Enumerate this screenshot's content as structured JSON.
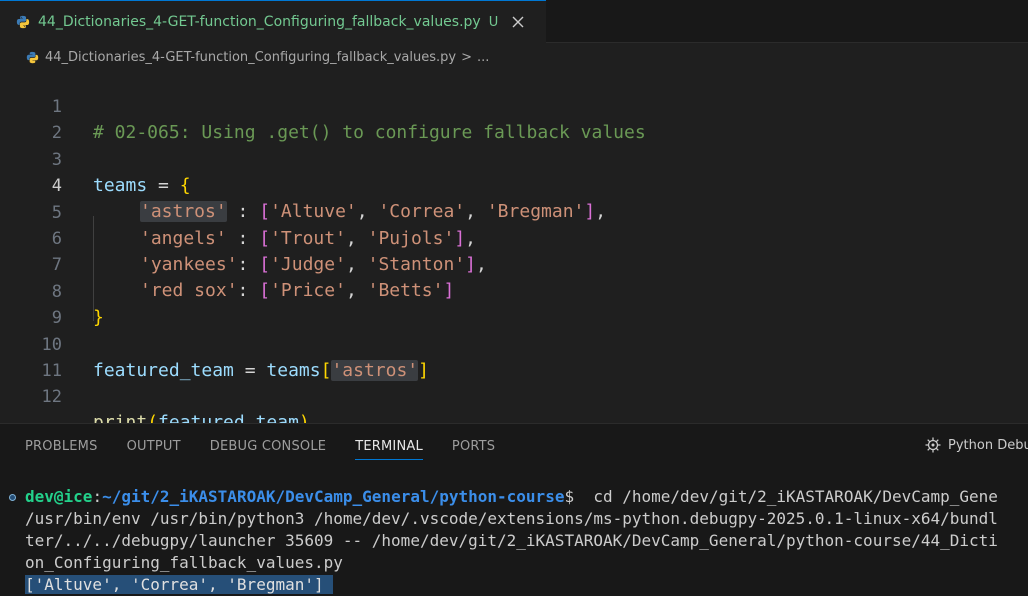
{
  "tab": {
    "title": "44_Dictionaries_4-GET-function_Configuring_fallback_values.py",
    "status": "U"
  },
  "breadcrumb": {
    "file": "44_Dictionaries_4-GET-function_Configuring_fallback_values.py",
    "separator": ">",
    "more": "..."
  },
  "editor": {
    "line_numbers": [
      "1",
      "2",
      "3",
      "4",
      "5",
      "6",
      "7",
      "8",
      "9",
      "10",
      "11",
      "12"
    ],
    "line1": {
      "comment": "# 02-065: Using .get() to configure fallback values"
    },
    "line3": {
      "var": "teams",
      "op": " = ",
      "brace": "{"
    },
    "line4": {
      "key": "'astros'",
      "colon": " : ",
      "open": "[",
      "v1": "'Altuve'",
      "c1": ", ",
      "v2": "'Correa'",
      "c2": ", ",
      "v3": "'Bregman'",
      "close": "]",
      "end": ","
    },
    "line5": {
      "key": "'angels'",
      "colon": " : ",
      "open": "[",
      "v1": "'Trout'",
      "c1": ", ",
      "v2": "'Pujols'",
      "close": "]",
      "end": ","
    },
    "line6": {
      "key": "'yankees'",
      "colon": ": ",
      "open": "[",
      "v1": "'Judge'",
      "c1": ", ",
      "v2": "'Stanton'",
      "close": "]",
      "end": ","
    },
    "line7": {
      "key": "'red sox'",
      "colon": ": ",
      "open": "[",
      "v1": "'Price'",
      "c1": ", ",
      "v2": "'Betts'",
      "close": "]"
    },
    "line8": {
      "brace": "}"
    },
    "line10": {
      "var": "featured_team",
      "op": " = ",
      "var2": "teams",
      "open": "[",
      "key": "'astros'",
      "close": "]"
    },
    "line12": {
      "fn": "print",
      "open": "(",
      "arg": "featured_team",
      "close": ")"
    }
  },
  "panel": {
    "tabs": [
      "PROBLEMS",
      "OUTPUT",
      "DEBUG CONSOLE",
      "TERMINAL",
      "PORTS"
    ],
    "right_label": "Python Debu"
  },
  "terminal": {
    "user": "dev@ice",
    "colon": ":",
    "path": "~/git/2_iKASTAROAK/DevCamp_General/python-course",
    "prompt": "$",
    "cmd": "  cd /home/dev/git/2_iKASTAROAK/DevCamp_Gene",
    "line2": "/usr/bin/env /usr/bin/python3 /home/dev/.vscode/extensions/ms-python.debugpy-2025.0.1-linux-x64/bundl",
    "line3": "ter/../../debugpy/launcher 35609 -- /home/dev/git/2_iKASTAROAK/DevCamp_General/python-course/44_Dicti",
    "line4": "on_Configuring_fallback_values.py",
    "output": "['Altuve', 'Correa', 'Bregman'] "
  }
}
